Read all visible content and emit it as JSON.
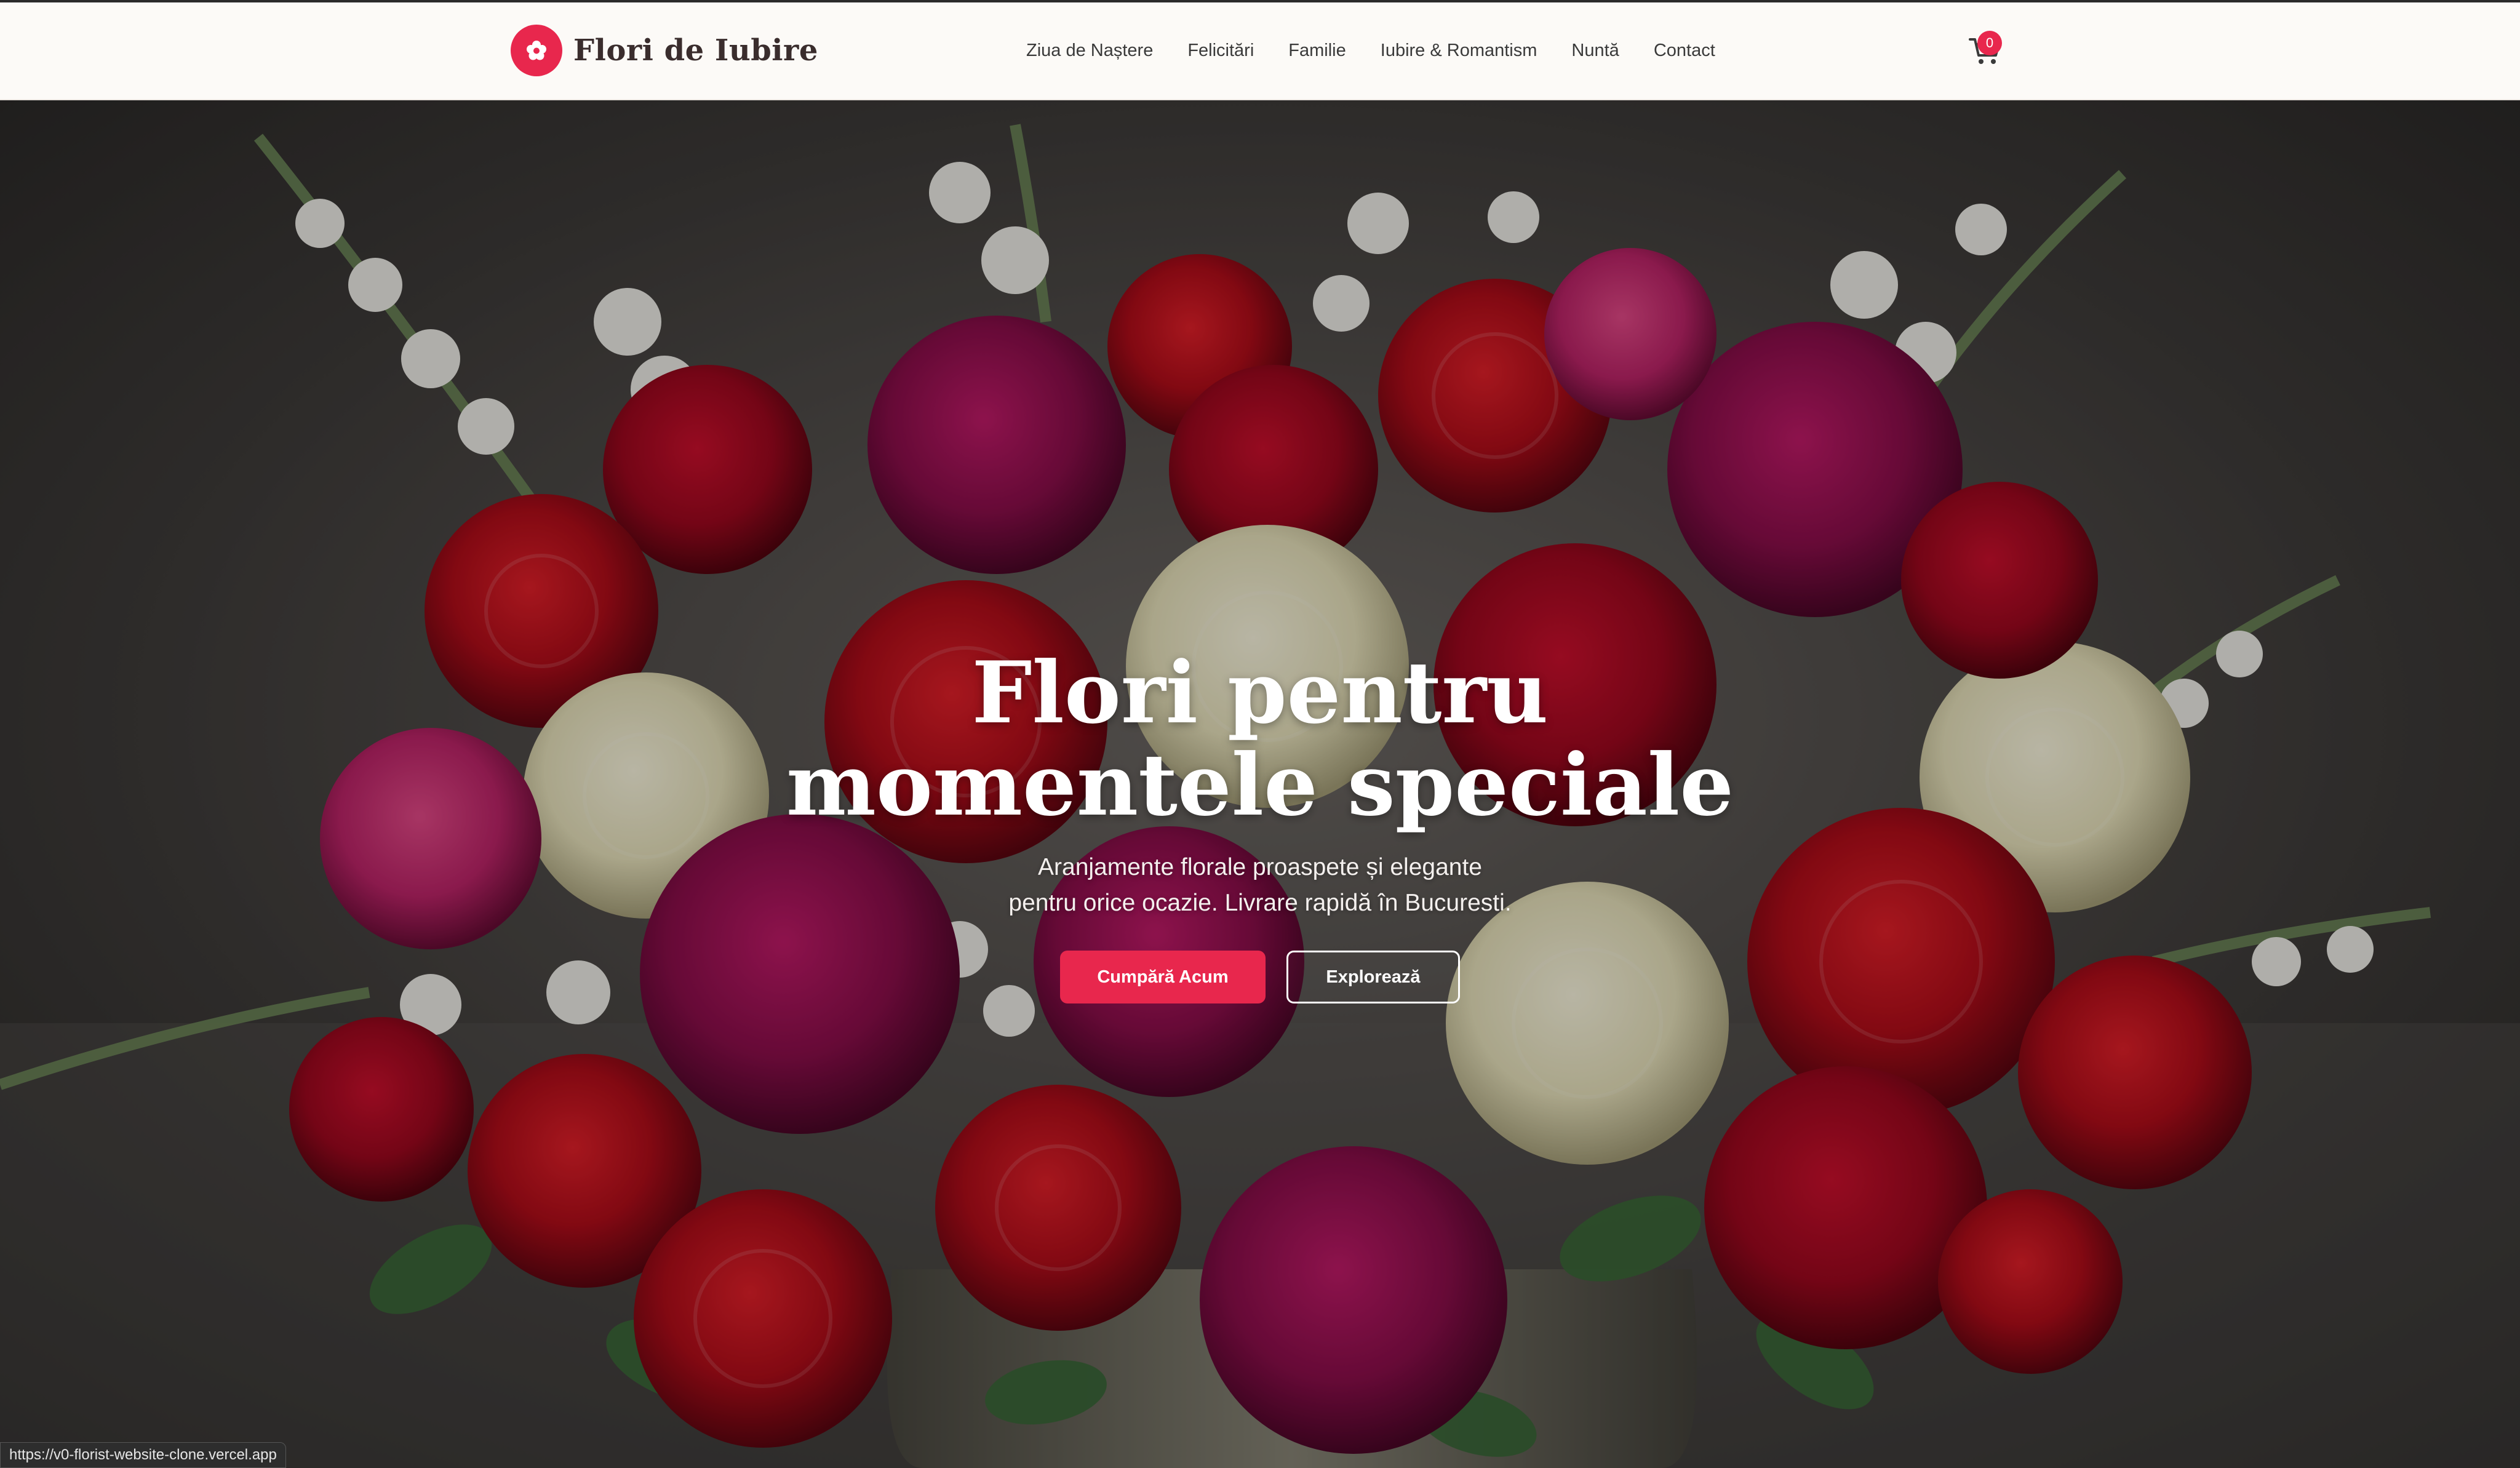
{
  "header": {
    "brand_name": "Flori de Iubire",
    "nav_items": [
      "Ziua de Naștere",
      "Felicitări",
      "Familie",
      "Iubire & Romantism",
      "Nuntă",
      "Contact"
    ],
    "cart_count": "0"
  },
  "hero": {
    "title_line1": "Flori pentru",
    "title_line2": "momentele speciale",
    "subtitle_line1": "Aranjamente florale proaspete și elegante",
    "subtitle_line2": "pentru orice ocazie. Livrare rapidă în Bucuresti.",
    "primary_button": "Cumpără Acum",
    "secondary_button": "Explorează"
  },
  "status_bar": {
    "url": "https://v0-florist-website-clone.vercel.app"
  },
  "icons": {
    "brand": "flower-icon",
    "cart": "shopping-cart-icon"
  },
  "colors": {
    "accent": "#e8274d",
    "header_bg": "#fcfaf7",
    "text_dark": "#3a3a3a"
  }
}
